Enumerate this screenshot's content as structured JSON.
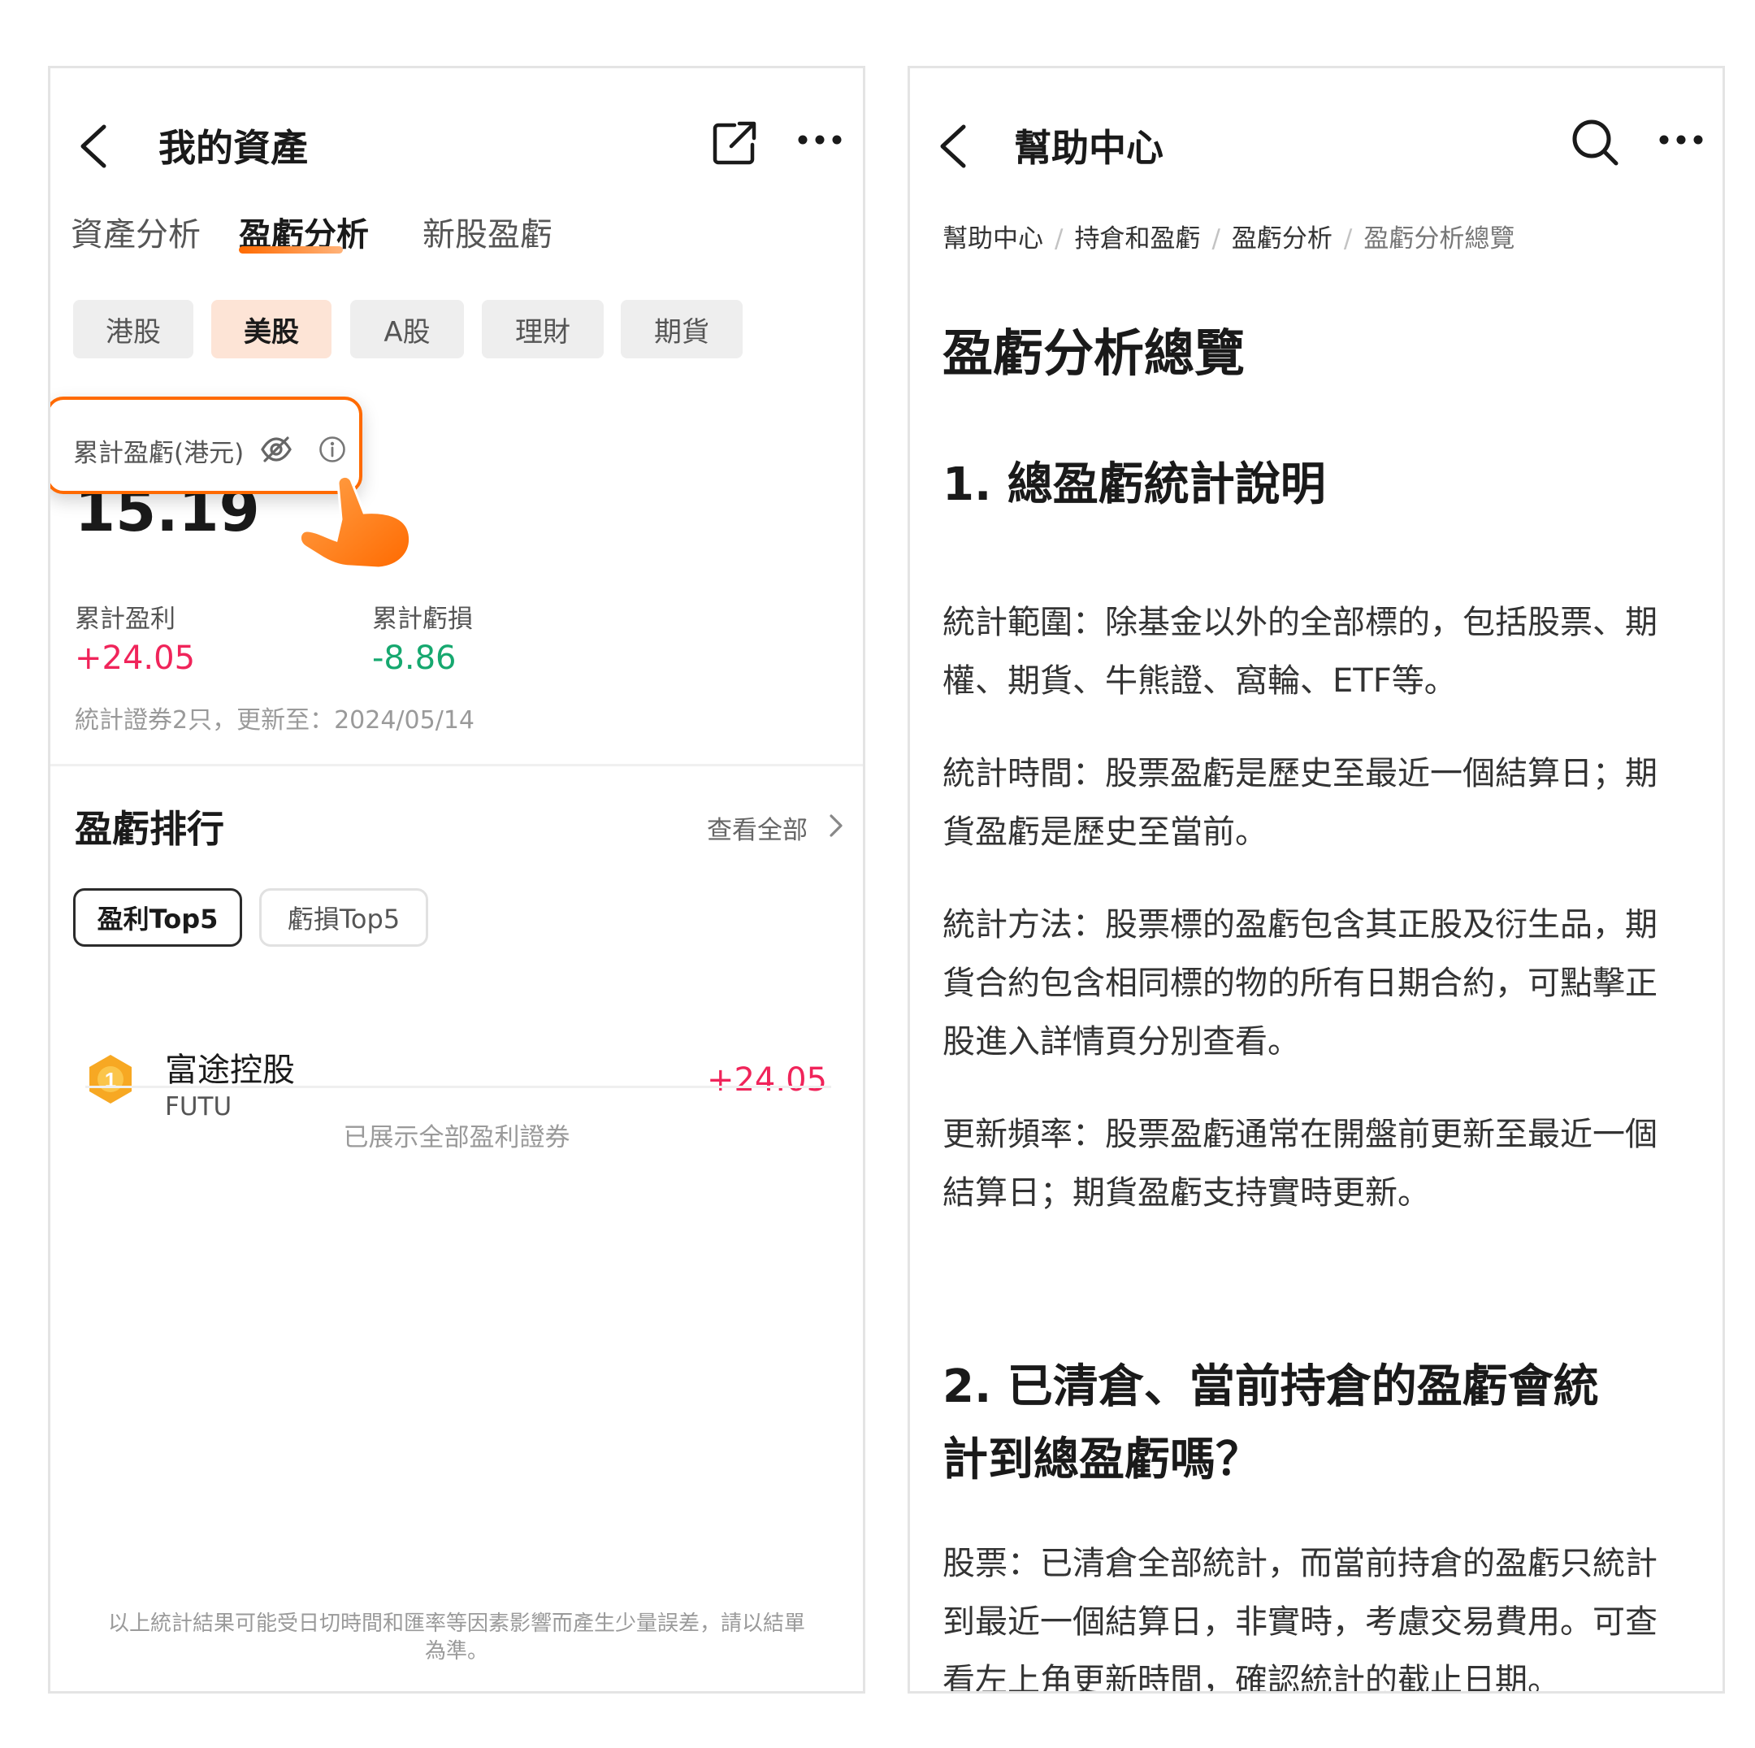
{
  "left": {
    "header": {
      "title": "我的資產"
    },
    "tabs": [
      {
        "label": "資產分析"
      },
      {
        "label": "盈虧分析"
      },
      {
        "label": "新股盈虧"
      }
    ],
    "markets": [
      {
        "label": "港股"
      },
      {
        "label": "美股"
      },
      {
        "label": "A股"
      },
      {
        "label": "理財"
      },
      {
        "label": "期貨"
      }
    ],
    "summary": {
      "label": "累計盈虧(港元)",
      "value": "15.19",
      "profit_label": "累計盈利",
      "profit_value": "+24.05",
      "loss_label": "累計虧損",
      "loss_value": "-8.86",
      "meta": "統計證券2只，更新至：2024/05/14"
    },
    "ranking": {
      "title": "盈虧排行",
      "view_all": "查看全部",
      "pills": [
        {
          "label": "盈利Top5"
        },
        {
          "label": "虧損Top5"
        }
      ],
      "rows": [
        {
          "rank": "1",
          "name": "富途控股",
          "code": "FUTU",
          "value": "+24.05"
        }
      ],
      "end_note": "已展示全部盈利證券"
    },
    "disclaimer": {
      "line1": "以上統計結果可能受日切時間和匯率等因素影響而產生少量誤差，請以結單",
      "line2": "為準。"
    }
  },
  "right": {
    "header": {
      "title": "幫助中心"
    },
    "breadcrumb": [
      "幫助中心",
      "持倉和盈虧",
      "盈虧分析",
      "盈虧分析總覽"
    ],
    "page_title": "盈虧分析總覽",
    "sections": [
      {
        "heading": "1. 總盈虧統計說明",
        "paragraphs": [
          {
            "line1": "統計範圍：除基金以外的全部標的，包括股票、期",
            "line2": "權、期貨、牛熊證、窩輪、ETF等。"
          },
          {
            "line1": "統計時間：股票盈虧是歷史至最近一個結算日；期",
            "line2": "貨盈虧是歷史至當前。"
          },
          {
            "line1": "統計方法：股票標的盈虧包含其正股及衍生品，期",
            "line2": "貨合約包含相同標的物的所有日期合約，可點擊正",
            "line3": "股進入詳情頁分別查看。"
          },
          {
            "line1": "更新頻率：股票盈虧通常在開盤前更新至最近一個",
            "line2": "結算日；期貨盈虧支持實時更新。"
          }
        ]
      },
      {
        "heading_line1": "2. 已清倉、當前持倉的盈虧會統",
        "heading_line2": "計到總盈虧嗎？",
        "paragraphs": [
          {
            "line1": "股票：已清倉全部統計，而當前持倉的盈虧只統計",
            "line2": "到最近一個結算日，非實時，考慮交易費用。可查",
            "line3": "看左上角更新時間，確認統計的截止日期。"
          }
        ]
      }
    ]
  },
  "colors": {
    "accent": "#ff6a00",
    "profit": "#f0245a",
    "loss": "#16a86f",
    "medal": "#f7a823"
  },
  "icons": [
    "back-arrow-icon",
    "share-icon",
    "more-icon",
    "eye-off-icon",
    "info-icon",
    "tap-hand-icon",
    "chevron-right-icon",
    "medal-icon",
    "search-icon"
  ]
}
